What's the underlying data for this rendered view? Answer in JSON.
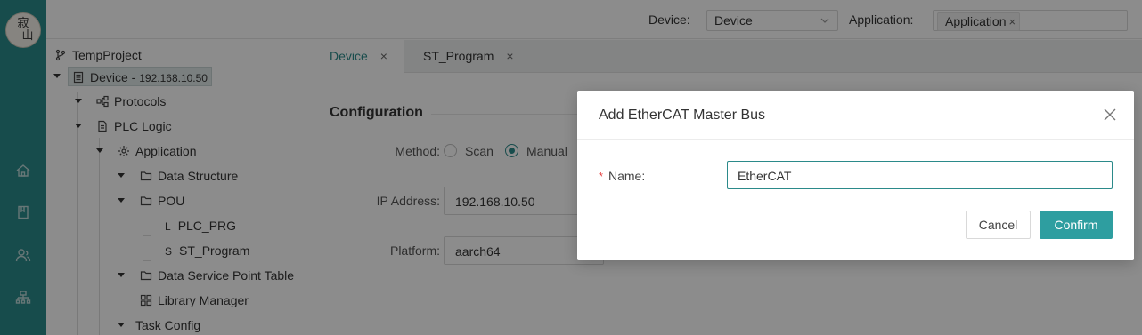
{
  "logo": {
    "line1": "寂",
    "line2": "山"
  },
  "rail": {
    "icons": [
      "home-icon",
      "book-icon",
      "users-icon",
      "network-icon"
    ]
  },
  "header": {
    "device_label": "Device:",
    "device_value": "Device",
    "application_label": "Application:",
    "application_tag": "Application",
    "application_tag_remove": "×"
  },
  "tree": {
    "project": "TempProject",
    "device_name": "Device - ",
    "device_ip": "192.168.10.50",
    "protocols": "Protocols",
    "plc_logic": "PLC Logic",
    "application": "Application",
    "data_structure": "Data Structure",
    "pou": "POU",
    "plc_prg_prefix": "L",
    "plc_prg": "PLC_PRG",
    "st_program_prefix": "S",
    "st_program": "ST_Program",
    "data_service_point_table": "Data Service Point Table",
    "library_manager": "Library Manager",
    "task_config": "Task Config"
  },
  "tabs": [
    {
      "label": "Device",
      "close": "×",
      "active": true
    },
    {
      "label": "ST_Program",
      "close": "×",
      "active": false
    }
  ],
  "config": {
    "title": "Configuration",
    "method_label": "Method:",
    "method_options": [
      "Scan",
      "Manual"
    ],
    "method_selected": "Manual",
    "ip_label": "IP Address:",
    "ip_value": "192.168.10.50",
    "platform_label": "Platform:",
    "platform_value": "aarch64"
  },
  "dialog": {
    "title": "Add EtherCAT Master Bus",
    "required_mark": "*",
    "name_label": "Name:",
    "name_value": "EtherCAT",
    "cancel": "Cancel",
    "confirm": "Confirm"
  },
  "colors": {
    "accent": "#2b8a8a",
    "confirm": "#2e9ea0",
    "required": "#e64545"
  }
}
